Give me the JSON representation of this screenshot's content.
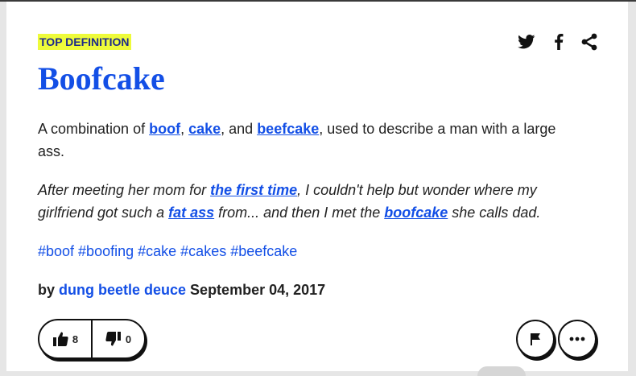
{
  "entry": {
    "badge": "TOP DEFINITION",
    "word": "Boofcake",
    "meaning": {
      "t1": "A combination of ",
      "l1": "boof",
      "t2": ", ",
      "l2": "cake",
      "t3": ", and ",
      "l3": "beefcake",
      "t4": ", used to describe a man with a large ass."
    },
    "example": {
      "t1": "After meeting her mom for ",
      "l1": "the first time",
      "t2": ", I couldn't help but wonder where my girlfriend got such a ",
      "l2": "fat ass",
      "t3": " from... and then I met the ",
      "l3": "boofcake",
      "t4": " she calls dad."
    },
    "tags": [
      "#boof",
      "#boofing",
      "#cake",
      "#cakes",
      "#beefcake"
    ],
    "byline": {
      "prefix": "by ",
      "author": "dung beetle deuce",
      "date": " September 04, 2017"
    },
    "votes": {
      "up": "8",
      "down": "0"
    }
  },
  "icons": {
    "twitter": "twitter-icon",
    "facebook": "facebook-icon",
    "share": "share-icon",
    "thumbs_up": "thumbs-up-icon",
    "thumbs_down": "thumbs-down-icon",
    "flag": "flag-icon",
    "more": "more-icon"
  },
  "colors": {
    "link": "#134fe6",
    "badge_bg": "#eefb3a",
    "badge_text": "#1d2a8a",
    "text": "#222222"
  }
}
